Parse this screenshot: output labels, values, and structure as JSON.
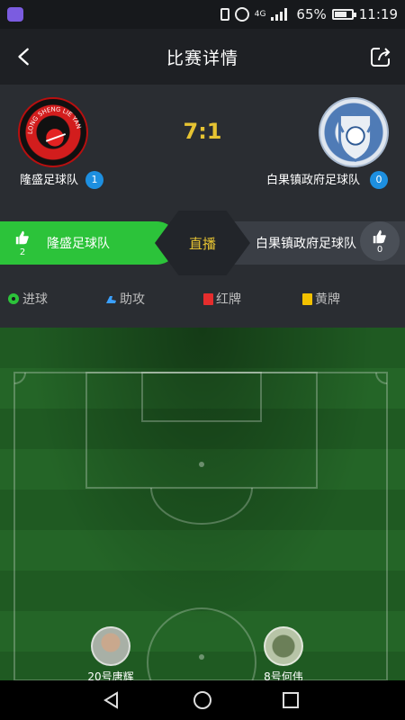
{
  "status_bar": {
    "network": "4G",
    "battery": "65%",
    "battery_level": 0.65,
    "time": "11:19"
  },
  "header": {
    "title": "比赛详情"
  },
  "match": {
    "score": "7:1",
    "home": {
      "name": "隆盛足球队",
      "count": "1",
      "logo_text": "LONG SHENG LIE YAN"
    },
    "away": {
      "name": "白果镇政府足球队",
      "count": "0"
    }
  },
  "votes": {
    "home_likes": "2",
    "away_likes": "0",
    "home_label": "隆盛足球队",
    "away_label": "白果镇政府足球队",
    "live_label": "直播"
  },
  "legend": {
    "goal": "进球",
    "assist": "助攻",
    "red_card": "红牌",
    "yellow_card": "黄牌"
  },
  "players": [
    {
      "name": "20号唐辉"
    },
    {
      "name": "8号何伟"
    }
  ],
  "colors": {
    "accent_green": "#2cc33a",
    "score_gold": "#e6c332",
    "badge_blue": "#1d8fe0"
  }
}
